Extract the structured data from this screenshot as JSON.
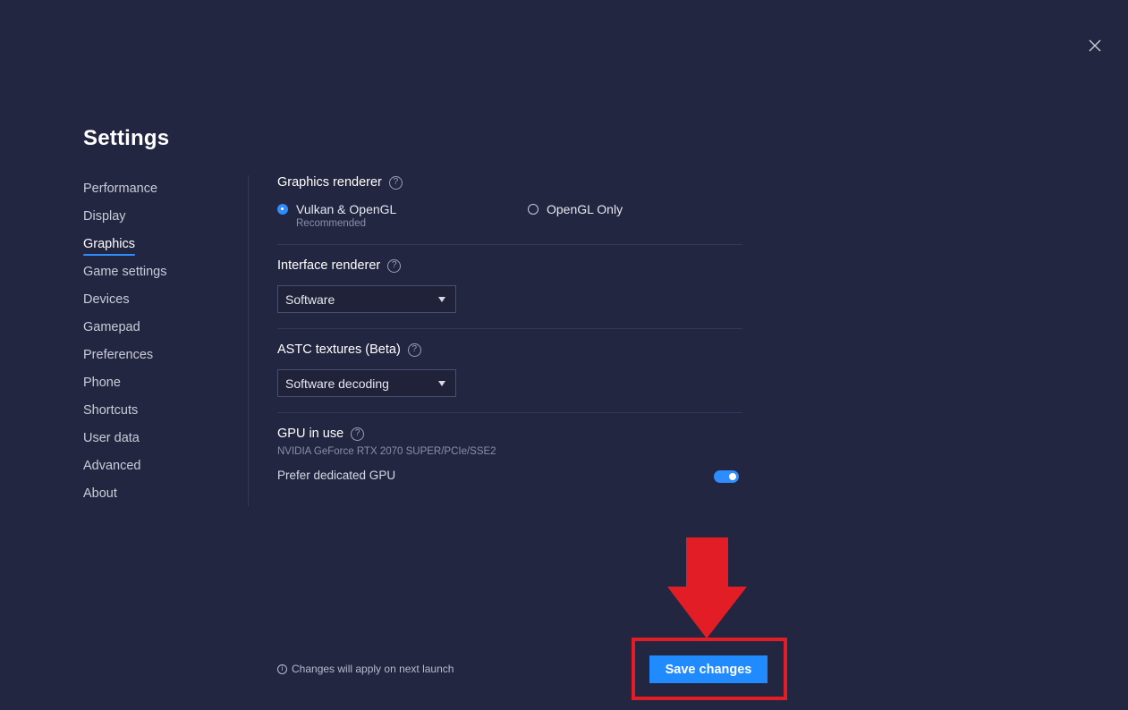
{
  "window": {
    "title": "Settings"
  },
  "sidebar": {
    "items": [
      {
        "label": "Performance",
        "active": false
      },
      {
        "label": "Display",
        "active": false
      },
      {
        "label": "Graphics",
        "active": true
      },
      {
        "label": "Game settings",
        "active": false
      },
      {
        "label": "Devices",
        "active": false
      },
      {
        "label": "Gamepad",
        "active": false
      },
      {
        "label": "Preferences",
        "active": false
      },
      {
        "label": "Phone",
        "active": false
      },
      {
        "label": "Shortcuts",
        "active": false
      },
      {
        "label": "User data",
        "active": false
      },
      {
        "label": "Advanced",
        "active": false
      },
      {
        "label": "About",
        "active": false
      }
    ]
  },
  "graphics": {
    "renderer": {
      "label": "Graphics renderer",
      "options": [
        {
          "label": "Vulkan & OpenGL",
          "sublabel": "Recommended",
          "selected": true
        },
        {
          "label": "OpenGL Only",
          "selected": false
        }
      ]
    },
    "interface_renderer": {
      "label": "Interface renderer",
      "value": "Software"
    },
    "astc": {
      "label": "ASTC textures (Beta)",
      "value": "Software decoding"
    },
    "gpu": {
      "label": "GPU in use",
      "name": "NVIDIA GeForce RTX 2070 SUPER/PCIe/SSE2",
      "prefer_dedicated_label": "Prefer dedicated GPU",
      "prefer_dedicated_on": true
    }
  },
  "footer": {
    "note": "Changes will apply on next launch",
    "save_label": "Save changes"
  },
  "icons": {
    "close": "close-icon",
    "help": "help-circle-icon",
    "info": "info-icon",
    "dropdown": "caret-down-icon",
    "annotation": "red-arrow-down-icon"
  },
  "colors": {
    "background": "#232640",
    "accent": "#1f8bff",
    "annotation": "#e21d26"
  }
}
